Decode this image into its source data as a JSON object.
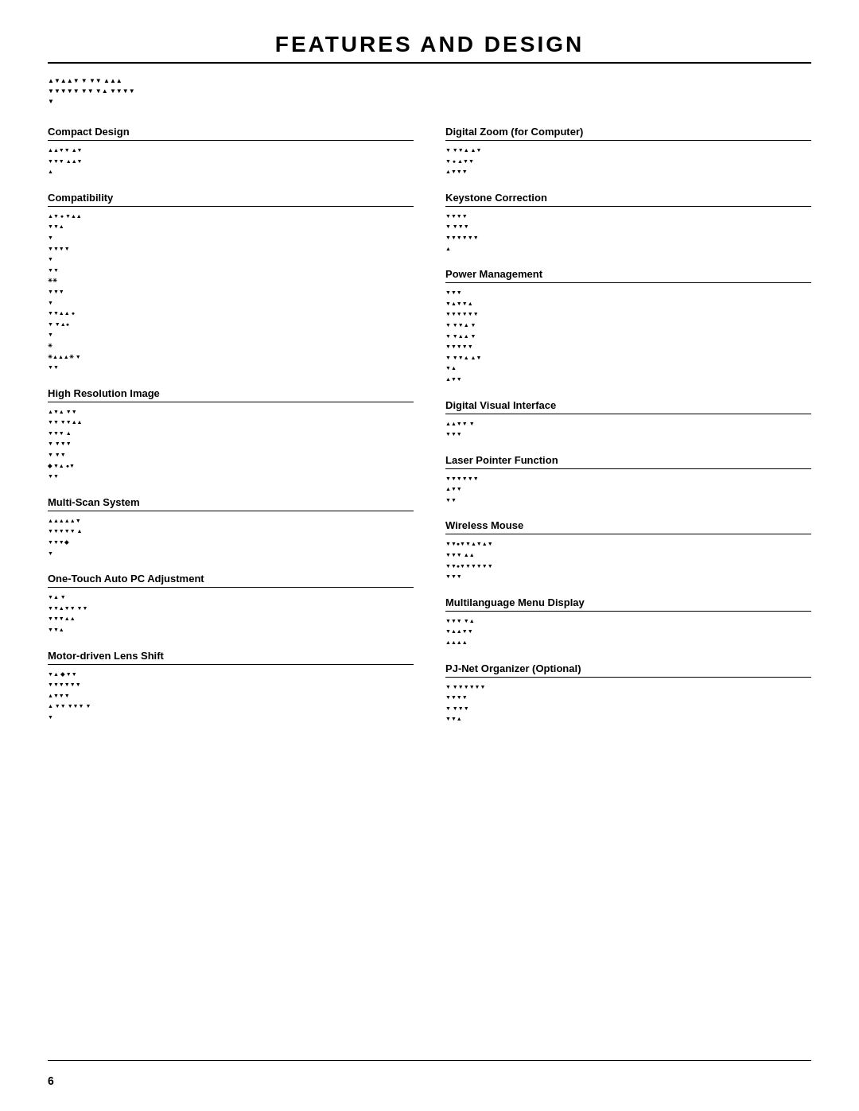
{
  "page": {
    "title": "FEATURES AND DESIGN",
    "footer_number": "6"
  },
  "intro": {
    "line1": "▲▼▲▲▼ ▼ ▼▼ ▲▲▲",
    "line2": "▼▼▼▼▼ ▼▼  ▼▲ ▼▼▼▼",
    "line3": "▼"
  },
  "left_column": [
    {
      "id": "compact-design",
      "title": "Compact Design",
      "body_lines": [
        "▲▲▼▼ ▲▼",
        "▼▼▼  ▲▲▼",
        "▲"
      ]
    },
    {
      "id": "compatibility",
      "title": "Compatibility",
      "body_lines": [
        "▲▼ ● ▼▲▲",
        "▼▼▲",
        "  ▼",
        "  ▼▼▼▼",
        "  ▼",
        "  ▼▼",
        "  ✳✳",
        "  ▼▼▼",
        "  ▼",
        "  ▼▼▲▲ ●",
        "  ▼ ▼▲●",
        "",
        "  ▼",
        "  ✳",
        "  ✳▲▲▲✳ ▼",
        "  ▼▼"
      ]
    },
    {
      "id": "high-resolution-image",
      "title": "High Resolution Image",
      "body_lines": [
        "▲▼▲  ▼▼",
        "▼▼ ▼▼▲▲",
        "▼▼▼  ▲",
        "▼  ▼▼▼",
        "▼  ▼▼",
        "◆ ▼▲   ●▼",
        "▼▼"
      ]
    },
    {
      "id": "multi-scan-system",
      "title": "Multi-Scan System",
      "body_lines": [
        "▲▲▲▲▲▼",
        "▼▼▼▼▼ ▲",
        "▼▼▼◆",
        "",
        "▼"
      ]
    },
    {
      "id": "one-touch-auto-pc",
      "title": "One-Touch Auto PC Adjustment",
      "body_lines": [
        "▼▲ ▼",
        "▼▼▲▼▼ ▼▼",
        "▼▼▼▲▲",
        "▼▼▲"
      ]
    },
    {
      "id": "motor-driven-lens-shift",
      "title": "Motor-driven Lens Shift",
      "body_lines": [
        "▼▲  ◆  ▼▼",
        "▼▼▼▼▼▼",
        "▲▼▼▼",
        "▲ ▼▼ ▼▼▼ ▼",
        "▼"
      ]
    }
  ],
  "right_column": [
    {
      "id": "digital-zoom",
      "title": "Digital Zoom (for Computer)",
      "body_lines": [
        "▼ ▼▼▲ ▲▼",
        "▼ ● ▲▼▼",
        "▲▼▼▼"
      ]
    },
    {
      "id": "keystone-correction",
      "title": "Keystone Correction",
      "body_lines": [
        "▼▼▼▼",
        "▼  ▼▼▼",
        "▼▼▼▼▼▼",
        "▲"
      ]
    },
    {
      "id": "power-management",
      "title": "Power Management",
      "body_lines": [
        "▼▼▼",
        "▼▲▼▼▲",
        "▼▼▼▼▼▼",
        "▼  ▼▼▲ ▼",
        "▼  ▼▲▲ ▼",
        "  ▼▼▼▼▼",
        "  ▼ ▼▼▲ ▲▼",
        "▼▲",
        "▲▼▼"
      ]
    },
    {
      "id": "digital-visual-interface",
      "title": "Digital Visual Interface",
      "body_lines": [
        "▲▲▼▼ ▼",
        "▼▼▼"
      ]
    },
    {
      "id": "laser-pointer-function",
      "title": "Laser Pointer Function",
      "body_lines": [
        "▼▼▼▼▼▼",
        "▲▼▼",
        "▼▼"
      ]
    },
    {
      "id": "wireless-mouse",
      "title": "Wireless Mouse",
      "body_lines": [
        "▼▼●▼▼▲▼▲▼",
        "▼▼▼ ▲▲",
        "▼▼●▼▼▼▼▼▼",
        "▼▼▼"
      ]
    },
    {
      "id": "multilanguage-menu-display",
      "title": "Multilanguage Menu Display",
      "body_lines": [
        "▼▼▼ ▼▲",
        "  ▼▲▲▼▼",
        "▲▲▲▲"
      ]
    },
    {
      "id": "pj-net-organizer",
      "title": "PJ-Net Organizer (Optional)",
      "body_lines": [
        "▼ ▼▼▼▼▼▼",
        "▼▼▼▼",
        "▼ ▼▼▼",
        "▼▼▲"
      ]
    }
  ]
}
